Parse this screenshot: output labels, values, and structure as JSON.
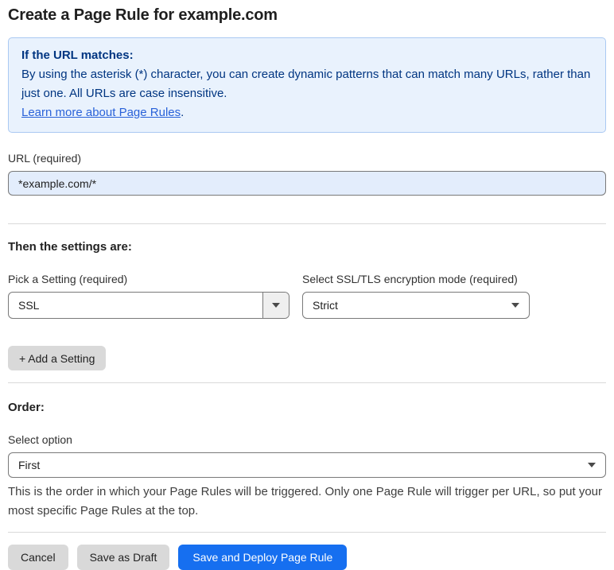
{
  "page": {
    "title": "Create a Page Rule for example.com"
  },
  "info_box": {
    "heading": "If the URL matches:",
    "body": "By using the asterisk (*) character, you can create dynamic patterns that can match many URLs, rather than just one. All URLs are case insensitive.",
    "link_label": "Learn more about Page Rules",
    "link_suffix": "."
  },
  "url_field": {
    "label": "URL (required)",
    "value": "*example.com/*"
  },
  "settings_section": {
    "heading": "Then the settings are:",
    "setting_select": {
      "label": "Pick a Setting (required)",
      "value": "SSL"
    },
    "mode_select": {
      "label": "Select SSL/TLS encryption mode (required)",
      "value": "Strict"
    },
    "add_setting_label": "+ Add a Setting"
  },
  "order_section": {
    "heading": "Order:",
    "select_label": "Select option",
    "value": "First",
    "help_text": "This is the order in which your Page Rules will be triggered. Only one Page Rule will trigger per URL, so put your most specific Page Rules at the top."
  },
  "footer": {
    "cancel_label": "Cancel",
    "save_draft_label": "Save as Draft",
    "save_deploy_label": "Save and Deploy Page Rule"
  },
  "colors": {
    "info_bg": "#e9f2fd",
    "info_border": "#aac9f2",
    "info_text": "#003581",
    "link_blue": "#2962d9",
    "input_bg": "#e3edfc",
    "input_border": "#797979",
    "primary_blue": "#166ff0",
    "button_gray": "#d9d9d9",
    "divider_gray": "#d9d9d9",
    "text_dark": "#222222"
  }
}
